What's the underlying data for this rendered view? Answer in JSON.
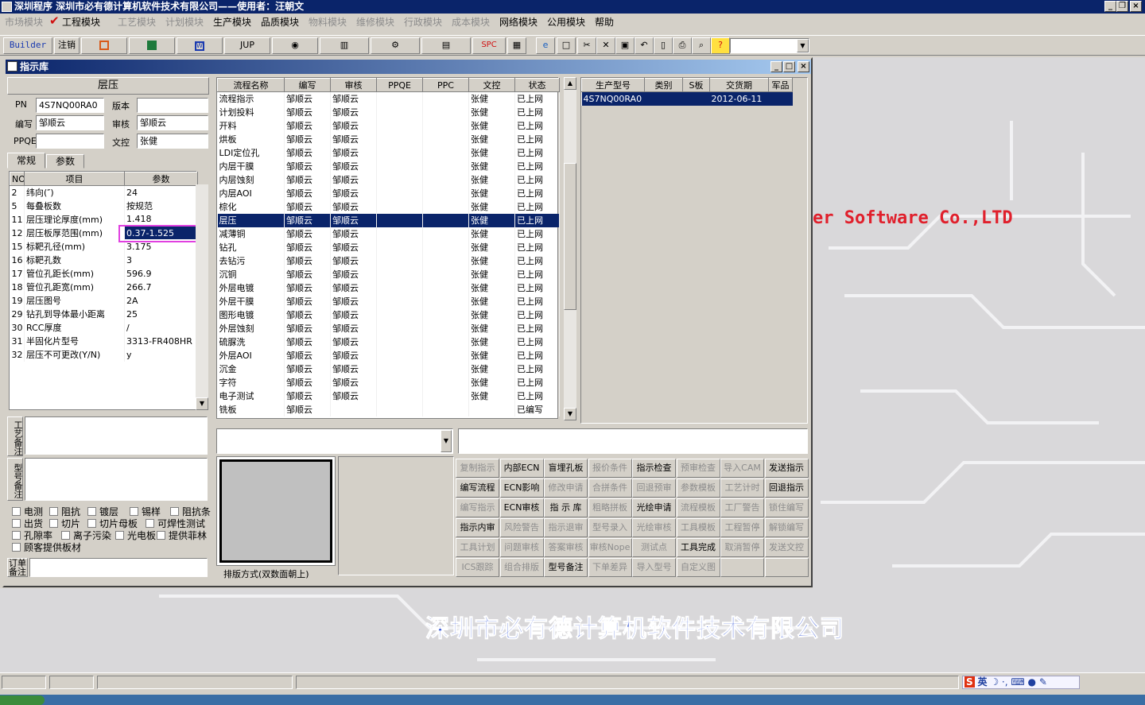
{
  "app": {
    "title": "深圳程序  深圳市必有德计算机软件技术有限公司——使用者：汪朝文"
  },
  "menu": [
    {
      "label": "市场模块",
      "enabled": false
    },
    {
      "label": "工程模块",
      "enabled": true
    },
    {
      "label": "工艺模块",
      "enabled": false
    },
    {
      "label": "计划模块",
      "enabled": false
    },
    {
      "label": "生产模块",
      "enabled": true
    },
    {
      "label": "品质模块",
      "enabled": true
    },
    {
      "label": "物料模块",
      "enabled": false
    },
    {
      "label": "维修模块",
      "enabled": false
    },
    {
      "label": "行政模块",
      "enabled": false
    },
    {
      "label": "成本模块",
      "enabled": false
    },
    {
      "label": "网络模块",
      "enabled": true
    },
    {
      "label": "公用模块",
      "enabled": true
    },
    {
      "label": "帮助",
      "enabled": true
    }
  ],
  "toolbar": {
    "builder": "Builder",
    "logout": "注销",
    "jup": "JUP",
    "spc": "SPC"
  },
  "window": {
    "title": "指示库"
  },
  "left": {
    "section": "层压",
    "pn_label": "PN",
    "pn": "4S7NQ00RA0",
    "version_label": "版本",
    "version": "",
    "editor_label": "编写",
    "editor": "邹顺云",
    "reviewer_label": "审核",
    "reviewer": "邹顺云",
    "ppqe_label": "PPQE",
    "ppqe": "",
    "control_label": "文控",
    "control": "张健",
    "tabs": [
      "常规",
      "参数"
    ],
    "param_headers": [
      "NO",
      "项目",
      "参数"
    ],
    "params": [
      [
        "2",
        "纬向(″)",
        "24"
      ],
      [
        "5",
        "每叠板数",
        "按规范"
      ],
      [
        "11",
        "层压理论厚度(mm)",
        "1.418"
      ],
      [
        "12",
        "层压板厚范围(mm)",
        "0.37-1.525"
      ],
      [
        "15",
        "标靶孔径(mm)",
        "3.175"
      ],
      [
        "16",
        "标靶孔数",
        "3"
      ],
      [
        "17",
        "管位孔距长(mm)",
        "596.9"
      ],
      [
        "18",
        "管位孔距宽(mm)",
        "266.7"
      ],
      [
        "19",
        "层压图号",
        "2A"
      ],
      [
        "29",
        "钻孔到导体最小距离",
        "25"
      ],
      [
        "30",
        "RCC厚度",
        "/"
      ],
      [
        "31",
        "半固化片型号",
        "3313-FR408HR"
      ],
      [
        "32",
        "层压不可更改(Y/N)",
        "y"
      ]
    ],
    "memo1": "工艺备注",
    "memo2": "型号备注",
    "memo3": "订单备注",
    "checks": [
      [
        "电测",
        "阻抗",
        "镀层",
        "锡样",
        "阻抗条"
      ],
      [
        "出货",
        "切片",
        "切片母板",
        "可焊性测试"
      ],
      [
        "孔隙率",
        "离子污染",
        "光电板",
        "提供菲林"
      ],
      [
        "顾客提供板材"
      ]
    ]
  },
  "flow": {
    "headers": [
      "流程名称",
      "编写",
      "审核",
      "PPQE",
      "PPC",
      "文控",
      "状态"
    ],
    "rows": [
      [
        "流程指示",
        "邹顺云",
        "邹顺云",
        "",
        "",
        "张健",
        "已上网"
      ],
      [
        "计划投料",
        "邹顺云",
        "邹顺云",
        "",
        "",
        "张健",
        "已上网"
      ],
      [
        "开料",
        "邹顺云",
        "邹顺云",
        "",
        "",
        "张健",
        "已上网"
      ],
      [
        "烘板",
        "邹顺云",
        "邹顺云",
        "",
        "",
        "张健",
        "已上网"
      ],
      [
        "LDI定位孔",
        "邹顺云",
        "邹顺云",
        "",
        "",
        "张健",
        "已上网"
      ],
      [
        "内层干膜",
        "邹顺云",
        "邹顺云",
        "",
        "",
        "张健",
        "已上网"
      ],
      [
        "内层蚀刻",
        "邹顺云",
        "邹顺云",
        "",
        "",
        "张健",
        "已上网"
      ],
      [
        "内层AOI",
        "邹顺云",
        "邹顺云",
        "",
        "",
        "张健",
        "已上网"
      ],
      [
        "棕化",
        "邹顺云",
        "邹顺云",
        "",
        "",
        "张健",
        "已上网"
      ],
      [
        "层压",
        "邹顺云",
        "邹顺云",
        "",
        "",
        "张健",
        "已上网"
      ],
      [
        "减薄铜",
        "邹顺云",
        "邹顺云",
        "",
        "",
        "张健",
        "已上网"
      ],
      [
        "钻孔",
        "邹顺云",
        "邹顺云",
        "",
        "",
        "张健",
        "已上网"
      ],
      [
        "去钻污",
        "邹顺云",
        "邹顺云",
        "",
        "",
        "张健",
        "已上网"
      ],
      [
        "沉铜",
        "邹顺云",
        "邹顺云",
        "",
        "",
        "张健",
        "已上网"
      ],
      [
        "外层电镀",
        "邹顺云",
        "邹顺云",
        "",
        "",
        "张健",
        "已上网"
      ],
      [
        "外层干膜",
        "邹顺云",
        "邹顺云",
        "",
        "",
        "张健",
        "已上网"
      ],
      [
        "图形电镀",
        "邹顺云",
        "邹顺云",
        "",
        "",
        "张健",
        "已上网"
      ],
      [
        "外层蚀刻",
        "邹顺云",
        "邹顺云",
        "",
        "",
        "张健",
        "已上网"
      ],
      [
        "硫脲洗",
        "邹顺云",
        "邹顺云",
        "",
        "",
        "张健",
        "已上网"
      ],
      [
        "外层AOI",
        "邹顺云",
        "邹顺云",
        "",
        "",
        "张健",
        "已上网"
      ],
      [
        "沉金",
        "邹顺云",
        "邹顺云",
        "",
        "",
        "张健",
        "已上网"
      ],
      [
        "字符",
        "邹顺云",
        "邹顺云",
        "",
        "",
        "张健",
        "已上网"
      ],
      [
        "电子测试",
        "邹顺云",
        "邹顺云",
        "",
        "",
        "张健",
        "已上网"
      ],
      [
        "铣板",
        "邹顺云",
        "",
        "",
        "",
        "",
        "已编写"
      ]
    ]
  },
  "models": {
    "headers": [
      "生产型号",
      "类别",
      "S板",
      "交货期",
      "军品"
    ],
    "rows": [
      [
        "4S7NQ00RA0",
        "",
        "",
        "2012-06-11",
        ""
      ]
    ]
  },
  "layout_label": "排版方式(双数面朝上)",
  "buttons": [
    [
      [
        "复制指示",
        false
      ],
      [
        "内部ECN",
        true
      ],
      [
        "盲埋孔板",
        true
      ],
      [
        "报价条件",
        false
      ],
      [
        "指示检查",
        true
      ],
      [
        "预审检查",
        false
      ],
      [
        "导入CAM",
        false
      ],
      [
        "发送指示",
        true
      ]
    ],
    [
      [
        "编写流程",
        true
      ],
      [
        "ECN影响",
        true
      ],
      [
        "修改申请",
        false
      ],
      [
        "合拼条件",
        false
      ],
      [
        "回退预审",
        false
      ],
      [
        "参数模板",
        false
      ],
      [
        "工艺计时",
        false
      ],
      [
        "回退指示",
        true
      ]
    ],
    [
      [
        "编写指示",
        false
      ],
      [
        "ECN审核",
        true
      ],
      [
        "指 示 库",
        true
      ],
      [
        "粗略拼板",
        false
      ],
      [
        "光绘申请",
        true
      ],
      [
        "流程模板",
        false
      ],
      [
        "工厂警告",
        false
      ],
      [
        "锁住编写",
        false
      ]
    ],
    [
      [
        "指示内审",
        true
      ],
      [
        "风险警告",
        false
      ],
      [
        "指示退审",
        false
      ],
      [
        "型号录入",
        false
      ],
      [
        "光绘审核",
        false
      ],
      [
        "工具模板",
        false
      ],
      [
        "工程暂停",
        false
      ],
      [
        "解锁编写",
        false
      ]
    ],
    [
      [
        "工具计划",
        false
      ],
      [
        "问题审核",
        false
      ],
      [
        "答案审核",
        false
      ],
      [
        "审核Nope",
        false
      ],
      [
        "测试点",
        false
      ],
      [
        "工具完成",
        true
      ],
      [
        "取消暂停",
        false
      ],
      [
        "发送文控",
        false
      ]
    ],
    [
      [
        "ICS跟踪",
        false
      ],
      [
        "组合排版",
        false
      ],
      [
        "型号备注",
        true
      ],
      [
        "下单差异",
        false
      ],
      [
        "导入型号",
        false
      ],
      [
        "自定义图",
        false
      ],
      [
        "",
        false
      ],
      [
        "",
        false
      ]
    ]
  ],
  "desktop": {
    "company_en": "er Software Co.,LTD",
    "company_cn": "深圳市必有德计算机软件技术有限公司"
  },
  "tray": {
    "ime": "英"
  },
  "colors": {
    "titlebar": "#0a246a",
    "selection": "#0a246a",
    "brand_red": "#e0202c",
    "highlight_box": "#e040e0",
    "company_blue": "#3b5bd8"
  }
}
